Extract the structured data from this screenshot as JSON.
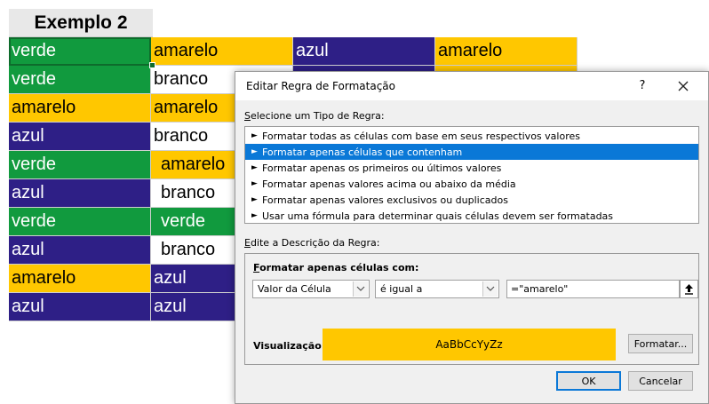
{
  "sheet": {
    "title": "Exemplo 2",
    "rows": [
      [
        {
          "text": "verde",
          "color": "green"
        },
        {
          "text": "amarelo",
          "color": "yellow"
        },
        {
          "text": "azul",
          "color": "purple"
        },
        {
          "text": "amarelo",
          "color": "yellow"
        }
      ],
      [
        {
          "text": "verde",
          "color": "green"
        },
        {
          "text": "branco",
          "color": "white"
        },
        {
          "text": "",
          "color": "purple"
        },
        {
          "text": "",
          "color": "yellow"
        }
      ],
      [
        {
          "text": "amarelo",
          "color": "yellow"
        },
        {
          "text": "amarelo",
          "color": "yellow"
        },
        {
          "text": "",
          "color": "purple"
        },
        {
          "text": "",
          "color": "yellow"
        }
      ],
      [
        {
          "text": "azul",
          "color": "purple"
        },
        {
          "text": "branco",
          "color": "white"
        },
        {
          "text": "",
          "color": "purple"
        },
        {
          "text": "",
          "color": "yellow"
        }
      ],
      [
        {
          "text": "verde",
          "color": "green"
        },
        {
          "text": "amarelo",
          "color": "yellow"
        },
        {
          "text": "",
          "color": "purple"
        },
        {
          "text": "",
          "color": "yellow"
        }
      ],
      [
        {
          "text": "azul",
          "color": "purple"
        },
        {
          "text": "branco",
          "color": "white"
        },
        {
          "text": "",
          "color": "purple"
        },
        {
          "text": "",
          "color": "yellow"
        }
      ],
      [
        {
          "text": "verde",
          "color": "green"
        },
        {
          "text": "verde",
          "color": "green"
        },
        {
          "text": "",
          "color": "purple"
        },
        {
          "text": "",
          "color": "yellow"
        }
      ],
      [
        {
          "text": "azul",
          "color": "purple"
        },
        {
          "text": "branco",
          "color": "white"
        },
        {
          "text": "",
          "color": "purple"
        },
        {
          "text": "",
          "color": "yellow"
        }
      ],
      [
        {
          "text": "amarelo",
          "color": "yellow"
        },
        {
          "text": "azul",
          "color": "purple"
        },
        {
          "text": "",
          "color": "purple"
        },
        {
          "text": "",
          "color": "yellow"
        }
      ],
      [
        {
          "text": "azul",
          "color": "purple"
        },
        {
          "text": "azul",
          "color": "purple"
        },
        {
          "text": "",
          "color": "purple"
        },
        {
          "text": "",
          "color": "yellow"
        }
      ]
    ]
  },
  "colors": {
    "green": "#119a3e",
    "yellow": "#ffc700",
    "purple": "#2e1f86",
    "white": "#ffffff",
    "selection_blue": "#0a78d7"
  },
  "dialog": {
    "title": "Editar Regra de Formatação",
    "help_label": "?",
    "close_icon": "close-icon",
    "rule_type_label_prefix": "S",
    "rule_type_label_rest": "elecione um Tipo de Regra:",
    "rule_types": [
      {
        "label": "Formatar todas as células com base em seus respectivos valores",
        "selected": false
      },
      {
        "label": "Formatar apenas células que contenham",
        "selected": true
      },
      {
        "label": "Formatar apenas os primeiros ou últimos valores",
        "selected": false
      },
      {
        "label": "Formatar apenas valores acima ou abaixo da média",
        "selected": false
      },
      {
        "label": "Formatar apenas valores exclusivos ou duplicados",
        "selected": false
      },
      {
        "label": "Usar uma fórmula para determinar quais células devem ser formatadas",
        "selected": false
      }
    ],
    "description_label_prefix": "E",
    "description_label_rest": "dite a Descrição da Regra:",
    "format_only_prefix": "F",
    "format_only_rest": "ormatar apenas células com:",
    "condition_type": "Valor da Célula",
    "operator": "é igual a",
    "formula_value": "=\"amarelo\"",
    "preview_label": "Visualização:",
    "preview_text": "AaBbCcYyZz",
    "format_button": "Formatar...",
    "ok_button": "OK",
    "cancel_button": "Cancelar"
  }
}
